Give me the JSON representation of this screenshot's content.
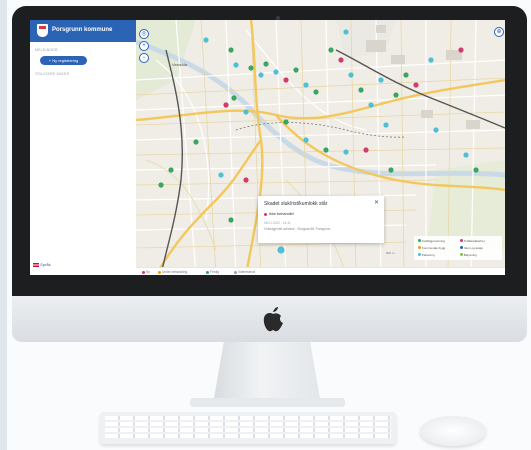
{
  "app": {
    "title": "Porsgrunn kommune",
    "section_label": "MELDINGER",
    "new_button": "+ Ny registrering",
    "history_label": "TIDLIGERE SAKER",
    "language": "Språk",
    "brand_color": "#2b63b5"
  },
  "map": {
    "place_label": "Vestsida",
    "zoom_in": "+",
    "zoom_out": "−",
    "locate": "◎",
    "layers": "⊕",
    "scale": "500 m"
  },
  "popup": {
    "title": "Skadet sluk/rist/kumlokk står",
    "close": "✕",
    "status": "Ikke behandlet",
    "date": "08.01.2022 - 14:31",
    "address": "Vinkelgjerdet adresse - Storgata 58, Porsgrunn"
  },
  "legend": {
    "items": [
      "Avfall/gjenvinning",
      "Kommunale bygg",
      "Parkering",
      "Trafikksikkerhet",
      "Vann og avløp",
      "Belysning"
    ],
    "colors": [
      "#3aa563",
      "#e8a317",
      "#4dc0d8",
      "#d23b6b",
      "#2b63b5",
      "#8bc34a"
    ]
  },
  "status_bar": {
    "items": [
      "Ny",
      "Under behandling",
      "Ferdig",
      "Videresendt"
    ],
    "colors": [
      "#d23b6b",
      "#e8a317",
      "#3aa563",
      "#9aa3ad"
    ]
  }
}
